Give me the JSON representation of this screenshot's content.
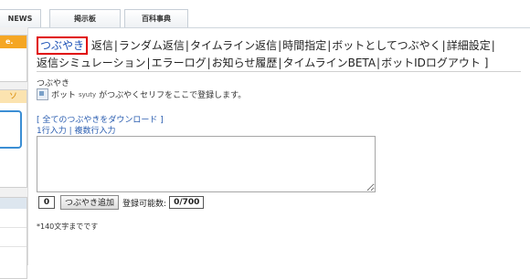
{
  "tabs": [
    {
      "label": "NEWS"
    },
    {
      "label": "掲示板"
    },
    {
      "label": "百科事典"
    }
  ],
  "sidebar": {
    "box1_header": "e."
  },
  "nav": {
    "items": [
      "つぶやき",
      "返信",
      "ランダム返信",
      "タイムライン返信",
      "時間指定",
      "ボットとしてつぶやく",
      "詳細設定",
      "返信シミュレーション",
      "エラーログ",
      "お知らせ履歴",
      "タイムラインBETA",
      "ボットIDログアウト"
    ],
    "closing": "]"
  },
  "section": {
    "title": "つぶやき",
    "bot_prefix": "ボット",
    "bot_id": "syuty",
    "bot_suffix": "がつぶやくセリフをここで登録します。",
    "download_link": "[ 全てのつぶやきをダウンロード ]",
    "mode_single": "1行入力",
    "mode_sep": "|",
    "mode_multi": "複数行入力"
  },
  "form": {
    "textarea_value": "",
    "counter": "0",
    "add_button": "つぶやき追加",
    "capacity_label": "登録可能数:",
    "capacity_value": "0/700",
    "note": "*140文字までです"
  }
}
